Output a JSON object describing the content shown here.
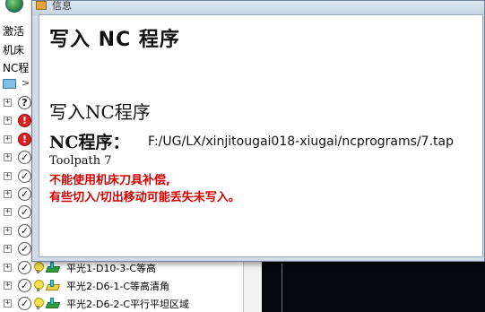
{
  "navigator": {
    "labels": [
      "激活",
      "机床",
      "NC程"
    ],
    "folder_arrow": ">",
    "operations": [
      {
        "status": "?",
        "status_type": "question",
        "name": ""
      },
      {
        "status": "!",
        "status_type": "error",
        "name": ""
      },
      {
        "status": "!",
        "status_type": "error",
        "name": ""
      },
      {
        "status": "✓",
        "status_type": "ok",
        "name": ""
      },
      {
        "status": "✓",
        "status_type": "ok",
        "name": ""
      },
      {
        "status": "✓",
        "status_type": "ok",
        "name": ""
      },
      {
        "status": "✓",
        "status_type": "ok",
        "name": ""
      },
      {
        "status": "✓",
        "status_type": "ok",
        "name": ""
      },
      {
        "status": "✓",
        "status_type": "ok",
        "name": ""
      },
      {
        "status": "✓",
        "status_type": "ok",
        "name": "平光1-D10-3-C等高"
      },
      {
        "status": "✓",
        "status_type": "ok",
        "name": "平光2-D6-1-C等高清角"
      },
      {
        "status": "✓",
        "status_type": "ok",
        "name": "平光2-D6-2-C平行平坦区域"
      }
    ]
  },
  "info_window": {
    "title": "信息",
    "heading": "写入 NC 程序",
    "subheading": "写入NC程序",
    "nc_program_label": "NC程序：",
    "nc_program_path": "F:/UG/LX/xinjitougai018-xiugai/ncprograms/7.tap",
    "toolpath_label": "Toolpath 7",
    "warning_line1": "不能使用机床刀具补偿,",
    "warning_line2": "有些切入/切出移动可能丢失未写入。"
  },
  "colors": {
    "warning_text": "#d40000",
    "dialog_frame": "#cfdbe8",
    "viewport_bg": "#06070c"
  }
}
